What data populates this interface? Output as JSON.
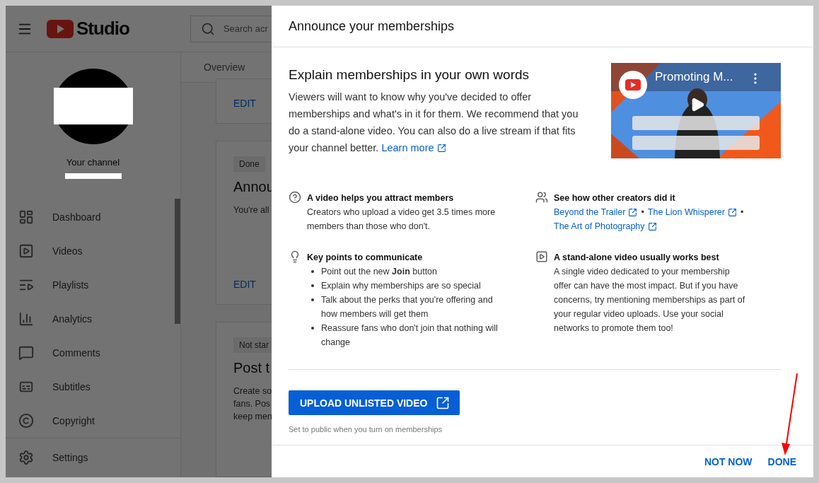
{
  "app": {
    "logo_text": "Studio",
    "search": {
      "placeholder": "Search acr"
    }
  },
  "sidebar": {
    "channel_label": "Your channel",
    "items": [
      {
        "label": "Dashboard"
      },
      {
        "label": "Videos"
      },
      {
        "label": "Playlists"
      },
      {
        "label": "Analytics"
      },
      {
        "label": "Comments"
      },
      {
        "label": "Subtitles"
      },
      {
        "label": "Copyright"
      }
    ],
    "footer_item": {
      "label": "Settings"
    }
  },
  "main": {
    "tabs": [
      {
        "label": "Overview"
      }
    ],
    "cards": [
      {
        "action": "EDIT"
      },
      {
        "status": "Done",
        "title": "Annou",
        "lines": [
          "You're all"
        ],
        "action": "EDIT"
      },
      {
        "status": "Not star",
        "title": "Post t",
        "lines": [
          "Create so",
          "fans. Pos",
          "keep men"
        ]
      }
    ]
  },
  "dialog": {
    "title": "Announce your memberships",
    "heading": "Explain memberships in your own words",
    "intro": "Viewers will want to know why you've decided to offer memberships and what's in it for them. We recommend that you do a stand-alone video. You can also do a live stream if that fits your channel better.",
    "intro_link": "Learn more",
    "video": {
      "title": "Promoting M..."
    },
    "tips": [
      {
        "kind": "text",
        "title": "A video helps you attract members",
        "text": "Creators who upload a video get 3.5 times more members than those who don't."
      },
      {
        "kind": "links",
        "title": "See how other creators did it",
        "separator": "•",
        "links": [
          "Beyond the Trailer",
          "The Lion Whisperer",
          "The Art of Photography"
        ]
      },
      {
        "kind": "list",
        "title": "Key points to communicate",
        "items": [
          "Point out the new **Join** button",
          "Explain why memberships are so special",
          "Talk about the perks that you're offering and how members will get them",
          "Reassure fans who don't join that nothing will change"
        ]
      },
      {
        "kind": "text",
        "title": "A stand-alone video usually works best",
        "text": "A single video dedicated to your membership offer can have the most impact. But if you have concerns, try mentioning memberships as part of your regular video uploads. Use your social networks to promote them too!"
      }
    ],
    "primary_button": "UPLOAD UNLISTED VIDEO",
    "caption": "Set to public when you turn on memberships",
    "buttons": [
      "NOT NOW",
      "DONE"
    ]
  }
}
